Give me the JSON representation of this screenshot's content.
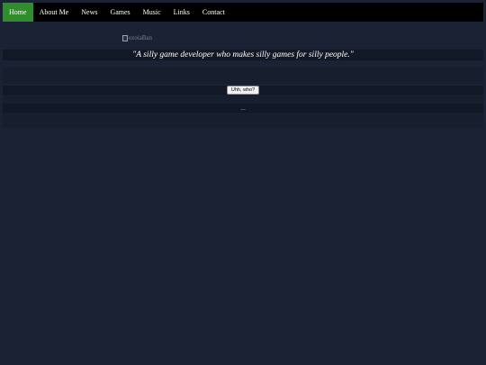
{
  "nav": {
    "items": [
      {
        "label": "Home",
        "active": true
      },
      {
        "label": "About Me"
      },
      {
        "label": "News"
      },
      {
        "label": "Games"
      },
      {
        "label": "Music"
      },
      {
        "label": "Links"
      },
      {
        "label": "Contact"
      }
    ],
    "active_color": "#2f8d2b"
  },
  "banner": {
    "alt_text": "ezoiaBan"
  },
  "tagline": "\"A silly game developer who makes silly games for silly people.\"",
  "who_button": {
    "label": "Uhh, who?"
  },
  "ellipsis": "..."
}
